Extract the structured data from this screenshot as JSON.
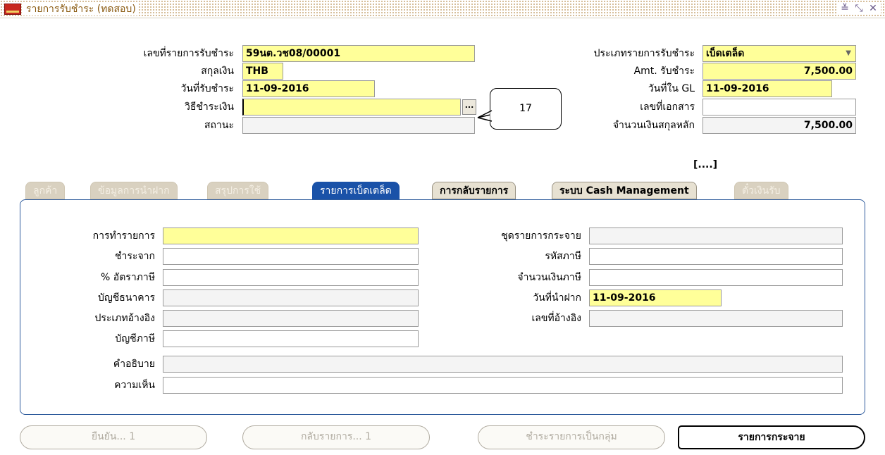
{
  "window": {
    "title": "รายการรับชำระ (ทดสอบ)",
    "controls": [
      "≚",
      "⤡",
      "✕"
    ]
  },
  "header": {
    "receipt_no_label": "เลขที่รายการรับชำระ",
    "receipt_no_value": "59นต.วช08/00001",
    "currency_label": "สกุลเงิน",
    "currency_value": "THB",
    "receipt_date_label": "วันที่รับชำระ",
    "receipt_date_value": "11-09-2016",
    "payment_method_label": "วิธีชำระเงิน",
    "payment_method_value": "",
    "status_label": "สถานะ",
    "status_value": "",
    "receipt_type_label": "ประเภทรายการรับชำระ",
    "receipt_type_value": "เบ็ดเตล็ด",
    "amount_label": "Amt. รับชำระ",
    "amount_value": "7,500.00",
    "gl_date_label": "วันที่ใน GL",
    "gl_date_value": "11-09-2016",
    "document_no_label": "เลขที่เอกสาร",
    "document_no_value": "",
    "functional_amount_label": "จำนวนเงินสกุลหลัก",
    "functional_amount_value": "7,500.00",
    "lov_button": "...",
    "flex_field": "[....]"
  },
  "callout": {
    "text": "17"
  },
  "tabs": [
    {
      "label": "ลูกค้า",
      "state": "disabled"
    },
    {
      "label": "ข้อมูลการนำฝาก",
      "state": "disabled"
    },
    {
      "label": "สรุปการใช้",
      "state": "disabled"
    },
    {
      "label": "รายการเบ็ดเตล็ด",
      "state": "active"
    },
    {
      "label": "การกลับรายการ",
      "state": "enabled"
    },
    {
      "label": "ระบบ Cash Management",
      "state": "enabled"
    },
    {
      "label": "ตั๋วเงินรับ",
      "state": "disabled"
    }
  ],
  "misc": {
    "activity_label": "การทำรายการ",
    "activity_value": "",
    "paid_from_label": "ชำระจาก",
    "paid_from_value": "",
    "tax_rate_label": "% อัตราภาษี",
    "tax_rate_value": "",
    "bank_account_label": "บัญชีธนาคาร",
    "bank_account_value": "",
    "reference_type_label": "ประเภทอ้างอิง",
    "reference_type_value": "",
    "tax_account_label": "บัญชีภาษี",
    "tax_account_value": "",
    "description_label": "คำอธิบาย",
    "description_value": "",
    "comments_label": "ความเห็น",
    "comments_value": "",
    "distribution_set_label": "ชุดรายการกระจาย",
    "distribution_set_value": "",
    "tax_code_label": "รหัสภาษี",
    "tax_code_value": "",
    "tax_amount_label": "จำนวนเงินภาษี",
    "tax_amount_value": "",
    "deposit_date_label": "วันที่นำฝาก",
    "deposit_date_value": "11-09-2016",
    "reference_no_label": "เลขที่อ้างอิง",
    "reference_no_value": ""
  },
  "buttons": {
    "confirm": "ยืนยัน... 1",
    "reverse": "กลับรายการ... 1",
    "batch_pay": "ชำระรายการเป็นกลุ่ม",
    "distributions": "รายการกระจาย"
  }
}
